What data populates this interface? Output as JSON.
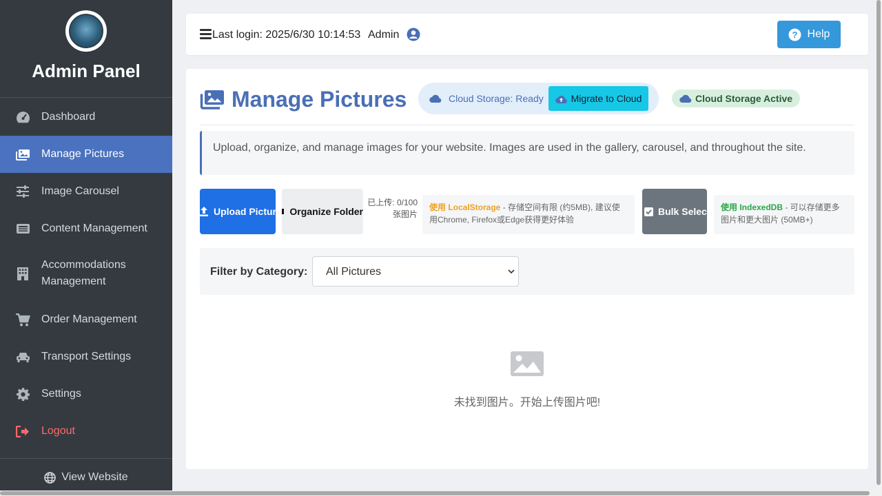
{
  "sidebar": {
    "brand_title": "Admin Panel",
    "items": [
      {
        "label": "Dashboard",
        "icon": "dashboard-icon"
      },
      {
        "label": "Manage Pictures",
        "icon": "images-icon",
        "active": true
      },
      {
        "label": "Image Carousel",
        "icon": "sliders-icon"
      },
      {
        "label": "Content Management",
        "icon": "content-icon"
      },
      {
        "label": "Accommodations Management",
        "icon": "building-icon"
      },
      {
        "label": "Order Management",
        "icon": "cart-icon"
      },
      {
        "label": "Transport Settings",
        "icon": "car-icon"
      },
      {
        "label": "Settings",
        "icon": "gear-icon"
      },
      {
        "label": "Logout",
        "icon": "logout-icon"
      }
    ],
    "footer_label": "View Website"
  },
  "topbar": {
    "last_login": "Last login: 2025/6/30 10:14:53",
    "user_name": "Admin",
    "help_label": "Help"
  },
  "page": {
    "title": "Manage Pictures",
    "cloud_status": "Cloud Storage: Ready",
    "migrate_label": "Migrate to Cloud",
    "cloud_active": "Cloud Storage Active",
    "info": "Upload, organize, and manage images for your website. Images are used in the gallery, carousel, and throughout the site.",
    "upload_label": "Upload Picture",
    "organize_label": "Organize Folder",
    "upload_count": "已上传: 0/100 张图片",
    "local_notice_hl": "使用 LocalStorage",
    "local_notice_rest": " - 存储空间有限 (约5MB), 建议使用Chrome, Firefox或Edge获得更好体验",
    "bulk_label": "Bulk Select",
    "idb_notice_hl": "使用 IndexedDB",
    "idb_notice_rest": " - 可以存储更多图片和更大图片 (50MB+)",
    "filter_label": "Filter by Category:",
    "filter_value": "All Pictures",
    "empty_text": "未找到图片。开始上传图片吧!"
  },
  "colors": {
    "sidebar_bg": "#343a40",
    "accent": "#4a72bf",
    "help": "#3498db",
    "upload": "#1f6fe5",
    "migrate": "#17c7e6",
    "bulk": "#6c757d",
    "logout": "#ff6b6b"
  }
}
